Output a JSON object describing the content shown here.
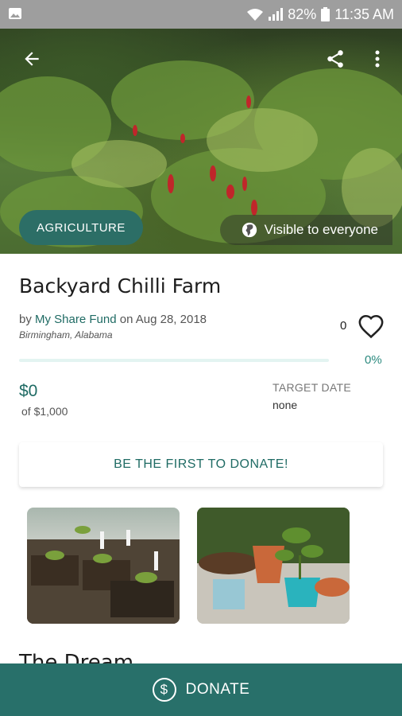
{
  "status_bar": {
    "battery": "82%",
    "time": "11:35 AM",
    "icons": [
      "image-icon",
      "wifi-icon",
      "signal-icon",
      "battery-icon"
    ]
  },
  "hero": {
    "category": "AGRICULTURE",
    "visibility": "Visible to everyone",
    "icons": [
      "back-arrow-icon",
      "share-icon",
      "more-vert-icon",
      "globe-icon"
    ]
  },
  "campaign": {
    "title": "Backyard Chilli Farm",
    "by_prefix": "by",
    "author": "My Share Fund",
    "date_prefix": "on",
    "date": "Aug 28, 2018",
    "location": "Birmingham, Alabama",
    "likes": "0",
    "progress_percent": "0%",
    "progress_fraction": 0,
    "raised": "$0",
    "goal": "of $1,000",
    "target_date_label": "TARGET DATE",
    "target_date_value": "none"
  },
  "cta": {
    "first_donate": "BE THE FIRST TO DONATE!",
    "donate_button": "DONATE"
  },
  "section": {
    "heading_peek": "The Dream"
  },
  "colors": {
    "accent": "#1f6b64",
    "donate_bar": "#28706a",
    "chip": "#2c6e66"
  }
}
